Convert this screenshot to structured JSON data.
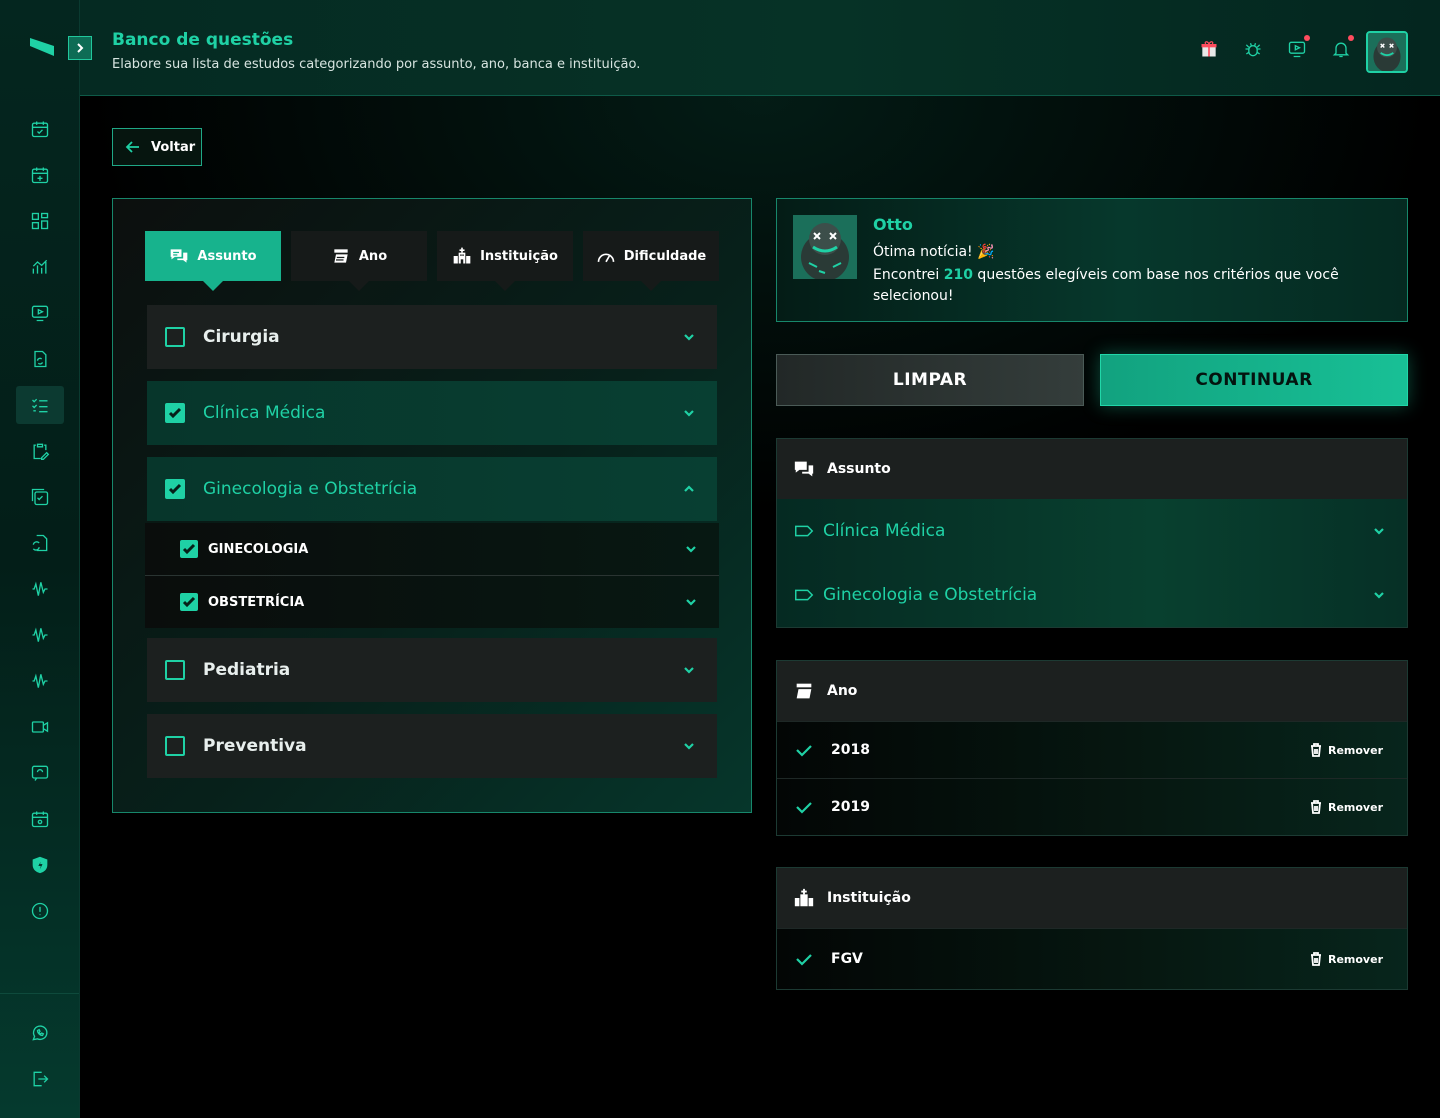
{
  "header": {
    "title": "Banco de questões",
    "subtitle": "Elabore sua lista de estudos categorizando por assunto, ano, banca e instituição."
  },
  "sidebar": {
    "icons": [
      "calendar-check-icon",
      "calendar-plus-icon",
      "grid-icon",
      "chart-icon",
      "video-icon",
      "refresh-icon",
      "list-icon",
      "clipboard-edit-icon",
      "calendar-check-2-icon",
      "file-refresh-icon",
      "waveform-icon",
      "waveform-2-icon",
      "waveform-3-icon",
      "camera-icon",
      "message-icon",
      "calendar-settings-icon",
      "shield-icon",
      "info-icon"
    ],
    "active_index": 6,
    "bottom_icons": [
      "whatsapp-icon",
      "logout-icon"
    ]
  },
  "top_icons": [
    "gift-icon",
    "bug-icon",
    "tv-icon",
    "bell-icon"
  ],
  "back_label": "Voltar",
  "tabs": [
    {
      "label": "Assunto",
      "icon": "chat-icon",
      "active": true
    },
    {
      "label": "Ano",
      "icon": "calendar-icon",
      "active": false
    },
    {
      "label": "Instituição",
      "icon": "building-icon",
      "active": false
    },
    {
      "label": "Dificuldade",
      "icon": "gauge-icon",
      "active": false
    }
  ],
  "subjects": [
    {
      "label": "Cirurgia",
      "checked": false,
      "expanded": false
    },
    {
      "label": "Clínica Médica",
      "checked": true,
      "expanded": false
    },
    {
      "label": "Ginecologia e Obstetrícia",
      "checked": true,
      "expanded": true,
      "children": [
        {
          "label": "GINECOLOGIA",
          "checked": true
        },
        {
          "label": "OBSTETRÍCIA",
          "checked": true
        }
      ]
    },
    {
      "label": "Pediatria",
      "checked": false,
      "expanded": false
    },
    {
      "label": "Preventiva",
      "checked": false,
      "expanded": false
    }
  ],
  "otto": {
    "name": "Otto",
    "message1": "Ótima notícia! 🎉",
    "message2_pre": "Encontrei ",
    "count": "210",
    "message2_post": " questões elegíveis com base nos critérios que você selecionou!"
  },
  "buttons": {
    "clear": "LIMPAR",
    "continue": "CONTINUAR"
  },
  "summary": {
    "assunto": {
      "title": "Assunto",
      "items": [
        "Clínica Médica",
        "Ginecologia e Obstetrícia"
      ]
    },
    "ano": {
      "title": "Ano",
      "items": [
        "2018",
        "2019"
      ]
    },
    "instituicao": {
      "title": "Instituição",
      "items": [
        "FGV"
      ]
    },
    "remove_label": "Remover"
  },
  "colors": {
    "accent": "#1fd1a5",
    "accent_dark": "#17b38d",
    "background": "#000000",
    "panel": "#1c201f"
  }
}
